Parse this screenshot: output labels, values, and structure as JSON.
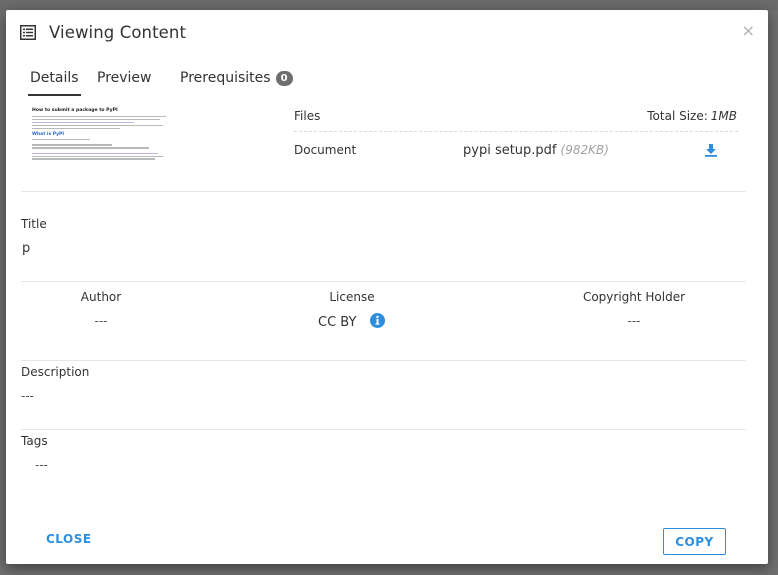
{
  "modal": {
    "title": "Viewing Content",
    "close_symbol": "×"
  },
  "tabs": [
    {
      "label": "Details",
      "active": true
    },
    {
      "label": "Preview",
      "active": false
    },
    {
      "label": "Prerequisites",
      "badge": "0",
      "active": false
    }
  ],
  "thumbnail": {
    "heading": "How to submit a package to PyPI",
    "subheading": "What is PyPI"
  },
  "files": {
    "header": "Files",
    "total_label": "Total Size:",
    "total_value": "1MB",
    "rows": [
      {
        "type": "Document",
        "name": "pypi setup.pdf",
        "size": "(982KB)",
        "icon": "download-icon"
      }
    ]
  },
  "title_section": {
    "label": "Title",
    "value": "p"
  },
  "author": {
    "label": "Author",
    "value": "---"
  },
  "license": {
    "label": "License",
    "value": "CC BY",
    "icon": "info-icon"
  },
  "copyright": {
    "label": "Copyright Holder",
    "value": "---"
  },
  "description": {
    "label": "Description",
    "value": "---"
  },
  "tags": {
    "label": "Tags",
    "value": "---"
  },
  "footer": {
    "close_label": "CLOSE",
    "copy_label": "COPY"
  },
  "colors": {
    "accent": "#2d8ee0",
    "badge": "#6e6e6e",
    "backdrop": "#6f6f6f"
  }
}
